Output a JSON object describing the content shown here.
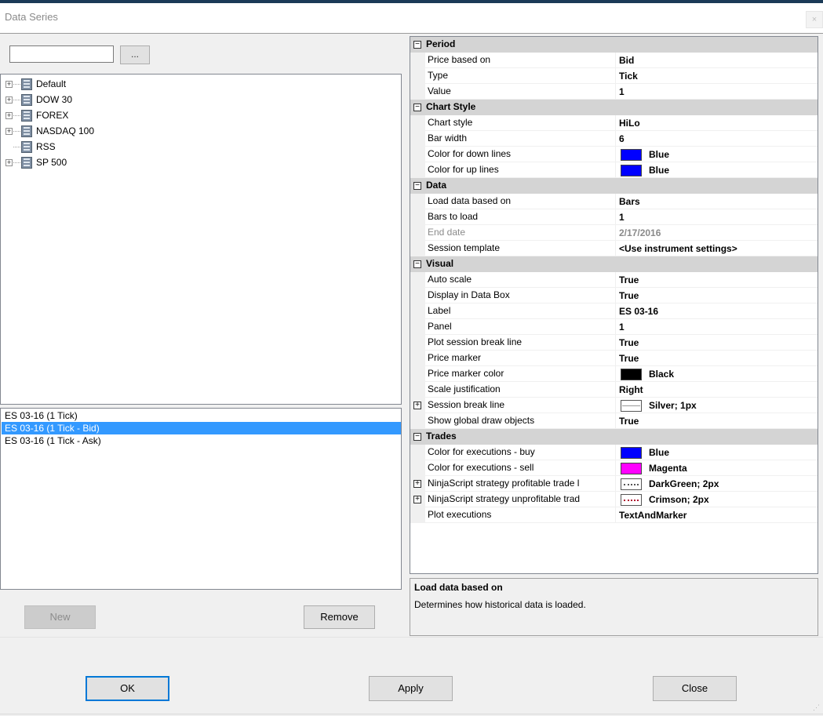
{
  "window": {
    "title": "Data Series",
    "close_glyph": "×"
  },
  "search": {
    "value": "",
    "placeholder": "",
    "browse_label": "..."
  },
  "tree": {
    "items": [
      {
        "label": "Default",
        "expandable": true
      },
      {
        "label": "DOW 30",
        "expandable": true
      },
      {
        "label": "FOREX",
        "expandable": true
      },
      {
        "label": "NASDAQ 100",
        "expandable": true
      },
      {
        "label": "RSS",
        "expandable": false
      },
      {
        "label": "SP 500",
        "expandable": true
      }
    ]
  },
  "series_list": {
    "items": [
      {
        "label": "ES 03-16 (1 Tick)",
        "selected": false
      },
      {
        "label": "ES 03-16 (1 Tick - Bid)",
        "selected": true
      },
      {
        "label": "ES 03-16 (1 Tick - Ask)",
        "selected": false
      }
    ]
  },
  "buttons": {
    "new": "New",
    "remove": "Remove",
    "ok": "OK",
    "apply": "Apply",
    "close": "Close"
  },
  "properties": [
    {
      "kind": "category",
      "name": "Period",
      "toggle": "⊟"
    },
    {
      "kind": "prop",
      "name": "Price based on",
      "value": "Bid"
    },
    {
      "kind": "prop",
      "name": "Type",
      "value": "Tick"
    },
    {
      "kind": "prop",
      "name": "Value",
      "value": "1"
    },
    {
      "kind": "category",
      "name": "Chart Style",
      "toggle": "⊟"
    },
    {
      "kind": "prop",
      "name": "Chart style",
      "value": "HiLo"
    },
    {
      "kind": "prop",
      "name": "Bar width",
      "value": "6"
    },
    {
      "kind": "prop",
      "name": "Color for down lines",
      "value": "Blue",
      "swatch": "#0000ff"
    },
    {
      "kind": "prop",
      "name": "Color for up lines",
      "value": "Blue",
      "swatch": "#0000ff"
    },
    {
      "kind": "category",
      "name": "Data",
      "toggle": "⊟"
    },
    {
      "kind": "prop",
      "name": "Load data based on",
      "value": "Bars"
    },
    {
      "kind": "prop",
      "name": "Bars to load",
      "value": "1"
    },
    {
      "kind": "prop",
      "name": "End date",
      "value": "2/17/2016",
      "disabled": true
    },
    {
      "kind": "prop",
      "name": "Session template",
      "value": "<Use instrument settings>"
    },
    {
      "kind": "category",
      "name": "Visual",
      "toggle": "⊟"
    },
    {
      "kind": "prop",
      "name": "Auto scale",
      "value": "True"
    },
    {
      "kind": "prop",
      "name": "Display in Data Box",
      "value": "True"
    },
    {
      "kind": "prop",
      "name": "Label",
      "value": "ES 03-16"
    },
    {
      "kind": "prop",
      "name": "Panel",
      "value": "1"
    },
    {
      "kind": "prop",
      "name": "Plot session break line",
      "value": "True"
    },
    {
      "kind": "prop",
      "name": "Price marker",
      "value": "True"
    },
    {
      "kind": "prop",
      "name": "Price marker color",
      "value": "Black",
      "swatch": "#000000"
    },
    {
      "kind": "prop",
      "name": "Scale justification",
      "value": "Right"
    },
    {
      "kind": "prop",
      "name": "Session break line",
      "value": "Silver; 1px",
      "swatch_style": "line",
      "expand": "⊞"
    },
    {
      "kind": "prop",
      "name": "Show global draw objects",
      "value": "True"
    },
    {
      "kind": "category",
      "name": "Trades",
      "toggle": "⊟"
    },
    {
      "kind": "prop",
      "name": "Color for executions - buy",
      "value": "Blue",
      "swatch": "#0000ff"
    },
    {
      "kind": "prop",
      "name": "Color for executions - sell",
      "value": "Magenta",
      "swatch": "#ff00ff"
    },
    {
      "kind": "prop",
      "name": "NinjaScript strategy profitable trade l",
      "value": "DarkGreen; 2px",
      "swatch_style": "dotted",
      "expand": "⊞"
    },
    {
      "kind": "prop",
      "name": "NinjaScript strategy unprofitable trad",
      "value": "Crimson; 2px",
      "swatch_style": "dotted-crimson",
      "expand": "⊞"
    },
    {
      "kind": "prop",
      "name": "Plot executions",
      "value": "TextAndMarker"
    }
  ],
  "help": {
    "title": "Load data based on",
    "description": "Determines how historical data is loaded."
  },
  "colors": {
    "selection": "#3399ff",
    "category_bg": "#d4d4d4",
    "default_button_border": "#0078d7"
  }
}
